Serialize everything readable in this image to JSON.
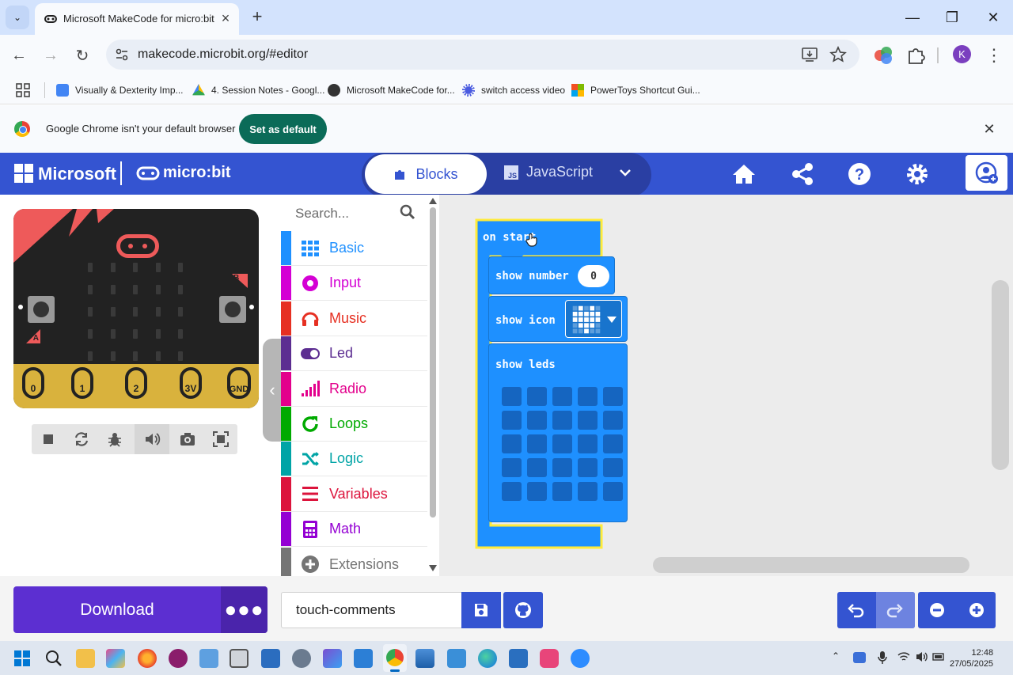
{
  "browser": {
    "tab_title": "Microsoft MakeCode for micro:bit",
    "url": "makecode.microbit.org/#editor",
    "avatar_letter": "K",
    "bookmarks": [
      {
        "label": "Visually & Dexterity Imp...",
        "icon": "docs-icon"
      },
      {
        "label": "4. Session Notes - Googl...",
        "icon": "drive-icon"
      },
      {
        "label": "Microsoft MakeCode for...",
        "icon": "makecode-icon"
      },
      {
        "label": "switch access video",
        "icon": "video-icon"
      },
      {
        "label": "PowerToys Shortcut Gui...",
        "icon": "microsoft-icon"
      }
    ],
    "infobar": {
      "text": "Google Chrome isn't your default browser",
      "button": "Set as default"
    }
  },
  "makecode": {
    "brand": "Microsoft",
    "product": "micro:bit",
    "mode_tabs": {
      "blocks": "Blocks",
      "javascript": "JavaScript"
    },
    "search_placeholder": "Search...",
    "categories": [
      {
        "label": "Basic",
        "color": "#1e90ff"
      },
      {
        "label": "Input",
        "color": "#d400d4"
      },
      {
        "label": "Music",
        "color": "#e63022"
      },
      {
        "label": "Led",
        "color": "#5c2d91"
      },
      {
        "label": "Radio",
        "color": "#e3008c"
      },
      {
        "label": "Loops",
        "color": "#00aa00"
      },
      {
        "label": "Logic",
        "color": "#00a4a6"
      },
      {
        "label": "Variables",
        "color": "#dc143c"
      },
      {
        "label": "Math",
        "color": "#9400d3"
      },
      {
        "label": "Extensions",
        "color": "#757575"
      }
    ],
    "blocks": {
      "on_start": "on start",
      "show_number": "show number",
      "show_number_value": "0",
      "show_icon": "show icon",
      "show_leds": "show leds"
    },
    "simulator": {
      "pins": [
        "0",
        "1",
        "2",
        "3V",
        "GND"
      ],
      "button_a": "A",
      "button_b": "B"
    },
    "download_label": "Download",
    "project_name": "touch-comments"
  },
  "taskbar": {
    "time": "12:48",
    "date": "27/05/2025"
  },
  "colors": {
    "header": "#3454d1",
    "block_basic": "#1e90ff",
    "download": "#5c2fd1"
  }
}
